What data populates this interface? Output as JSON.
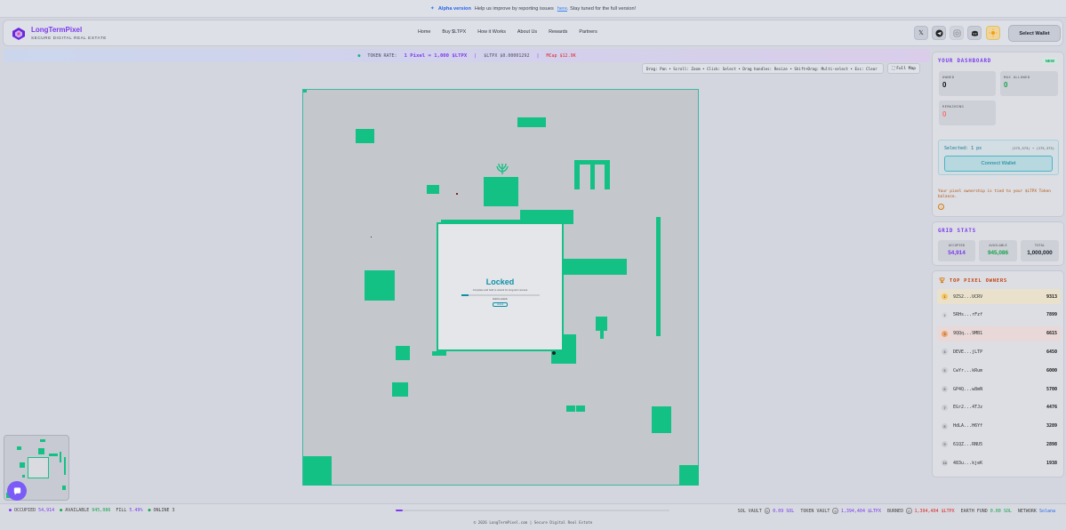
{
  "banner": {
    "tag": "Alpha version",
    "message": "Help us improve by reporting issues",
    "link": "here",
    "suffix": ". Stay tuned for the full version!"
  },
  "header": {
    "brand": "LongTermPixel",
    "tagline": "SECURE DIGITAL REAL ESTATE",
    "nav": [
      "Home",
      "Buy $LTPX",
      "How it Works",
      "About Us",
      "Rewards",
      "Partners"
    ],
    "wallet_button": "Select Wallet",
    "icons": [
      "x-icon",
      "telegram-icon",
      "instagram-icon",
      "discord-icon",
      "theme-sun-icon"
    ]
  },
  "rate_strip": {
    "label": "TOKEN RATE:",
    "rate": "1 Pixel = 1,000 $LTPX",
    "price": "$LTPX $0.00001292",
    "mcap": "MCap $12.9K"
  },
  "controls": {
    "hint": "Drag: Pan • Scroll: Zoom • Click: Select • Drag handles: Resize • Shift+Drag: Multi-select • Esc: Clear",
    "full_map": "Full Map"
  },
  "locked": {
    "title": "Locked",
    "subtitle": "Complete and hold to unlock for long-term access",
    "progress": 0.1,
    "note": "Hold to unlock",
    "button": "Unlock"
  },
  "dashboard": {
    "title": "YOUR DASHBOARD",
    "badge": "NEW",
    "owned_label": "OWNED",
    "owned": "0",
    "max_allowed_label": "MAX ALLOWED",
    "max_allowed": "0",
    "remaining_label": "REMAINING",
    "remaining": "0"
  },
  "selection": {
    "selected": "Selected: 1 px",
    "coords": "(275,373) → (275,373)",
    "connect": "Connect Wallet",
    "warning": "Your pixel ownership is tied to your $LTPX Token balance."
  },
  "grid_stats": {
    "title": "GRID STATS",
    "occupied_label": "OCCUPIED",
    "occupied": "54,914",
    "available_label": "AVAILABLE",
    "available": "945,086",
    "total_label": "TOTAL",
    "total": "1,000,000"
  },
  "top_owners": {
    "title": "TOP PIXEL OWNERS",
    "rows": [
      {
        "rank": "1",
        "addr": "9ZS2...UCRV",
        "count": "9313"
      },
      {
        "rank": "2",
        "addr": "5RHs...rFzf",
        "count": "7899"
      },
      {
        "rank": "3",
        "addr": "9QQq...9MB1",
        "count": "6615"
      },
      {
        "rank": "4",
        "addr": "DEVE...jLTP",
        "count": "6450"
      },
      {
        "rank": "5",
        "addr": "CwYr...kRum",
        "count": "6000"
      },
      {
        "rank": "6",
        "addr": "GP4Q...w8mN",
        "count": "5700"
      },
      {
        "rank": "7",
        "addr": "EGr2...4TJz",
        "count": "4476"
      },
      {
        "rank": "8",
        "addr": "HdLA...H6Yf",
        "count": "3289"
      },
      {
        "rank": "9",
        "addr": "61QZ...RNU5",
        "count": "2898"
      },
      {
        "rank": "10",
        "addr": "483u...kjeK",
        "count": "1938"
      }
    ]
  },
  "minimap": {
    "label": "MINIMAP"
  },
  "footer": {
    "occupied_label": "OCCUPIED",
    "occupied": "54,914",
    "available_label": "AVAILABLE",
    "available": "945,086",
    "fill_label": "FILL",
    "fill": "5.49%",
    "online_label": "ONLINE",
    "online": "3",
    "fill_fraction": 0.0549,
    "sol_vault_label": "SOL VAULT",
    "sol_vault": "0.09 SOL",
    "token_vault_label": "TOKEN VAULT",
    "token_vault": "1,394,404 $LTPX",
    "burned_label": "BURNED",
    "burned": "1,394,404 $LTPX",
    "earth_fund_label": "EARTH FUND",
    "earth_fund": "0.00 SOL",
    "network_label": "NETWORK",
    "network": "Solana",
    "copyright": "© 2026 LongTermPixel.com | Secure Digital Real Estate"
  },
  "colors": {
    "accent": "#7c3aed",
    "pixel": "#14c185",
    "teal": "#0d8fa8"
  }
}
